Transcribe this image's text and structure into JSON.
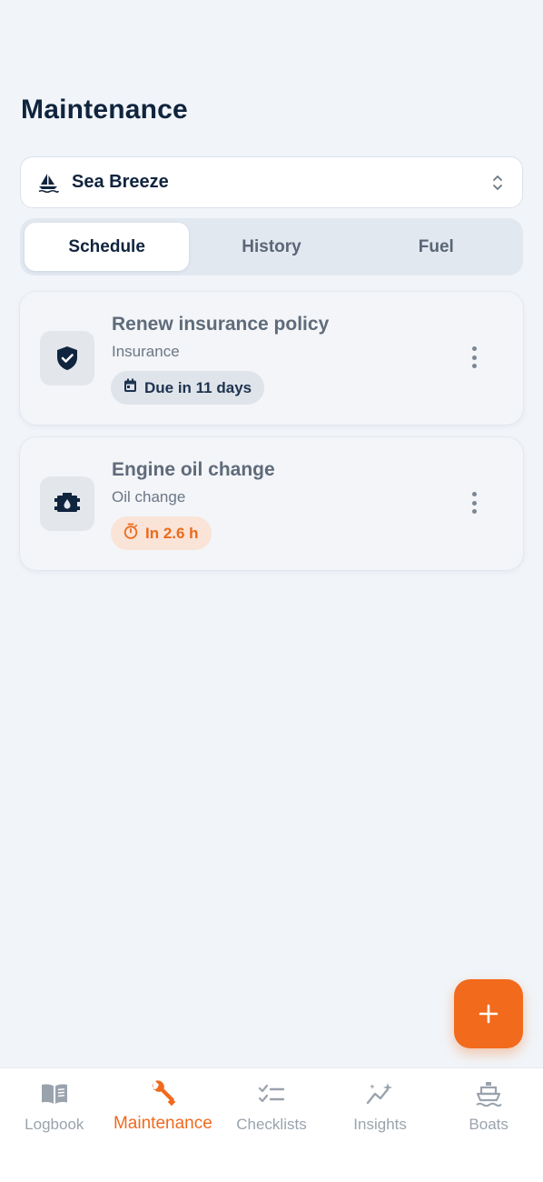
{
  "page": {
    "title": "Maintenance"
  },
  "boat_selector": {
    "name": "Sea Breeze",
    "icon": "sailboat-icon"
  },
  "tabs": [
    {
      "label": "Schedule",
      "active": true
    },
    {
      "label": "History",
      "active": false
    },
    {
      "label": "Fuel",
      "active": false
    }
  ],
  "tasks": [
    {
      "title": "Renew insurance policy",
      "subtitle": "Insurance",
      "badge": "Due in 11 days",
      "badge_icon": "calendar-icon",
      "icon": "shield-check-icon"
    },
    {
      "title": "Engine oil change",
      "subtitle": "Oil change",
      "badge": "In 2.6 h",
      "badge_icon": "stopwatch-icon",
      "icon": "oil-can-icon"
    }
  ],
  "fab": {
    "icon": "plus-icon"
  },
  "nav": [
    {
      "label": "Logbook",
      "icon": "book-icon",
      "active": false
    },
    {
      "label": "Maintenance",
      "icon": "wrench-icon",
      "active": true
    },
    {
      "label": "Checklists",
      "icon": "checklist-icon",
      "active": false
    },
    {
      "label": "Insights",
      "icon": "sparkle-chart-icon",
      "active": false
    },
    {
      "label": "Boats",
      "icon": "ship-icon",
      "active": false
    }
  ],
  "colors": {
    "accent": "#f26a1b",
    "text": "#10243e",
    "muted": "#9aa3ad",
    "background": "#f1f5f9"
  }
}
